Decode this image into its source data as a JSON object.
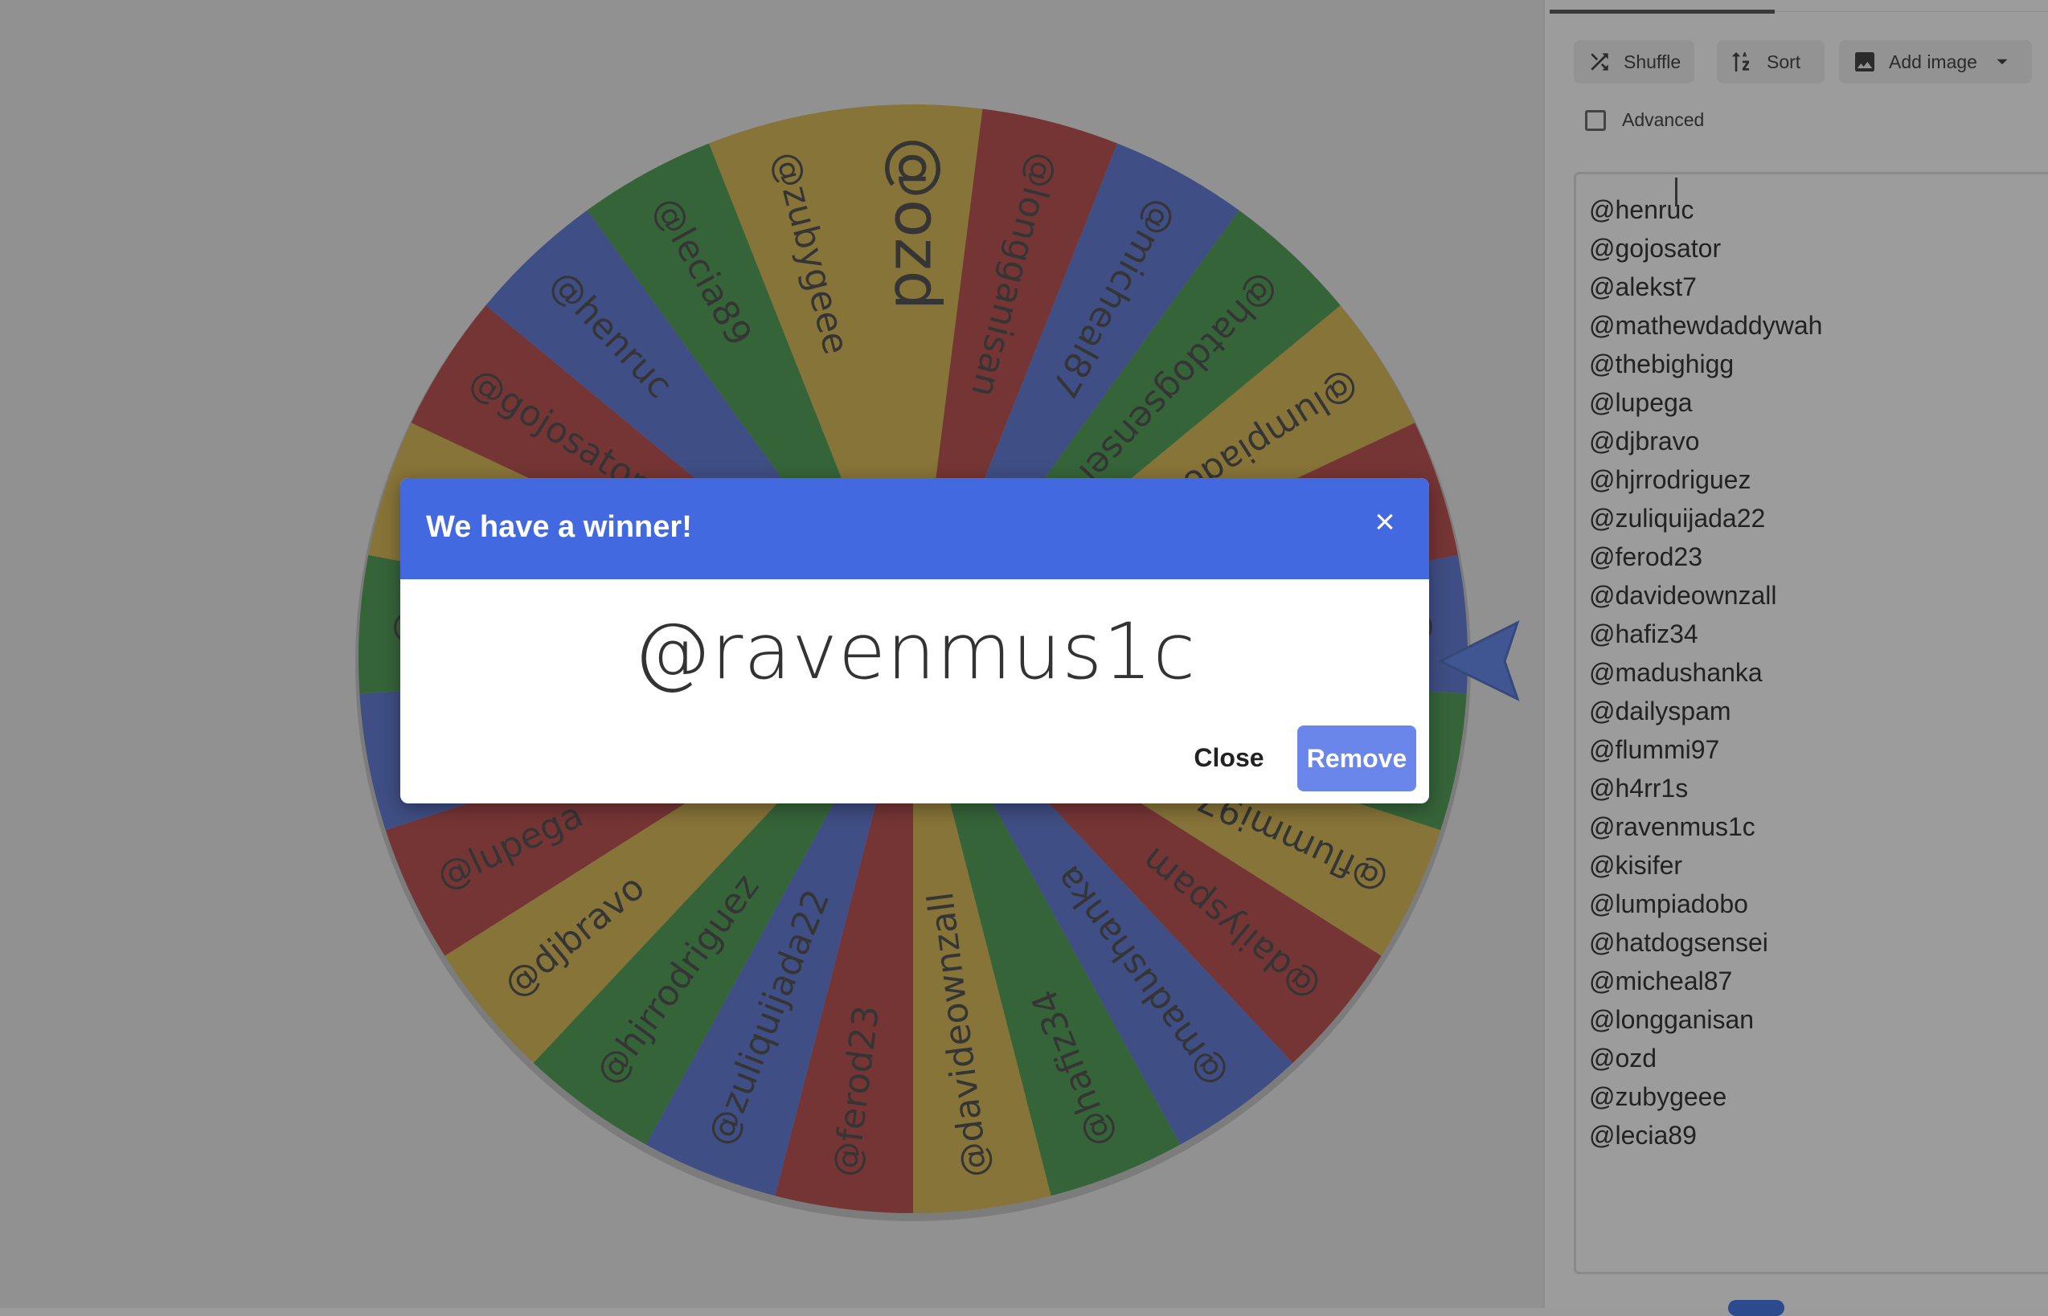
{
  "wheel": {
    "entries": [
      "@ozd",
      "@longganisan",
      "@micheal87",
      "@hatdogsensei",
      "@lumpiadobo",
      "@kisifer",
      "@ravenmus1c",
      "@h4rr1s",
      "@flummi97",
      "@dailyspam",
      "@madushanka",
      "@hafiz34",
      "@davideownzall",
      "@ferod23",
      "@zuliquijada22",
      "@hjrrodriguez",
      "@djbravo",
      "@lupega",
      "@thebighigg",
      "@mathewdaddywah",
      "@alekst7",
      "@gojosator",
      "@henruc",
      "@lecia89",
      "@zubygeee"
    ],
    "colors": [
      "#8e7320",
      "#761c1c",
      "#2a3f8a",
      "#1e5e22"
    ],
    "pointer_color": "#2a4a9e"
  },
  "toolbar": {
    "shuffle_label": "Shuffle",
    "sort_label": "Sort",
    "add_image_label": "Add image"
  },
  "advanced": {
    "label": "Advanced",
    "checked": false
  },
  "entries_list": [
    "@henruc",
    "@gojosator",
    "@alekst7",
    "@mathewdaddywah",
    "@thebighigg",
    "@lupega",
    "@djbravo",
    "@hjrrodriguez",
    "@zuliquijada22",
    "@ferod23",
    "@davideownzall",
    "@hafiz34",
    "@madushanka",
    "@dailyspam",
    "@flummi97",
    "@h4rr1s",
    "@ravenmus1c",
    "@kisifer",
    "@lumpiadobo",
    "@hatdogsensei",
    "@micheal87",
    "@longganisan",
    "@ozd",
    "@zubygeee",
    "@lecia89"
  ],
  "dialog": {
    "title": "We have a winner!",
    "close_x": "×",
    "winner": "@ravenmus1c",
    "close_label": "Close",
    "remove_label": "Remove"
  }
}
